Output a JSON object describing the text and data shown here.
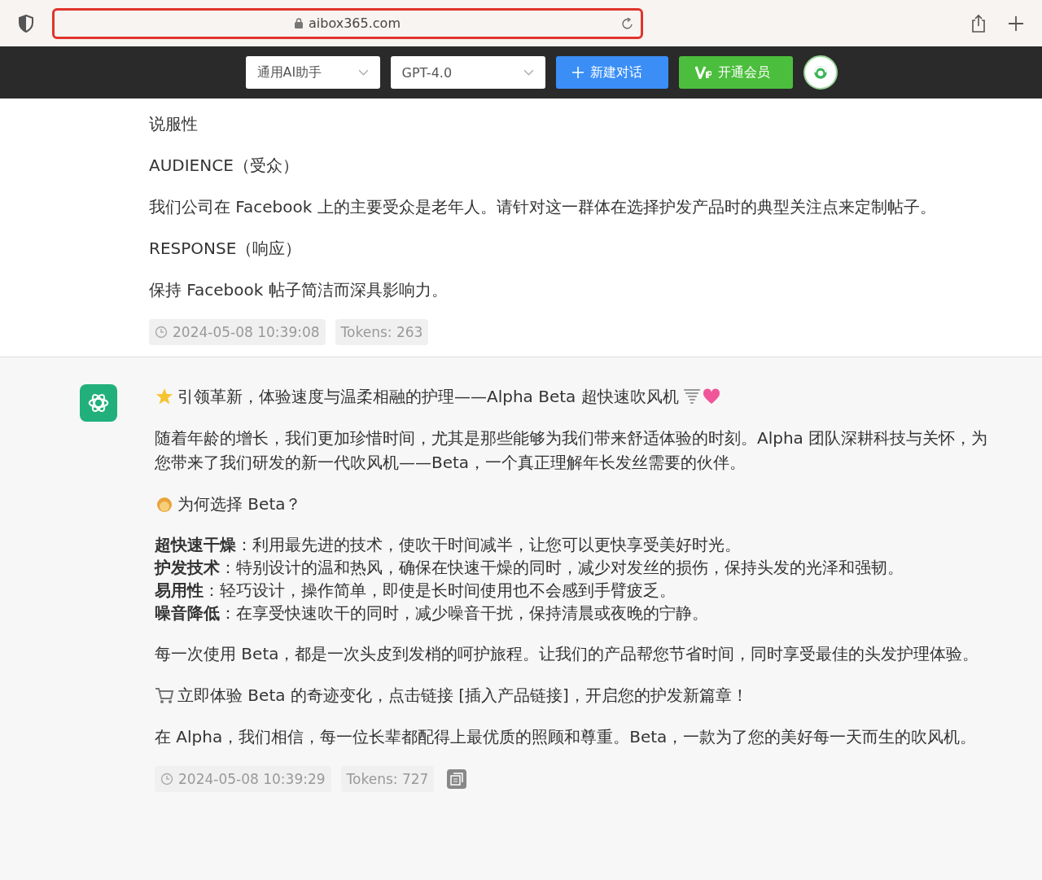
{
  "browser": {
    "url": "aibox365.com"
  },
  "toolbar": {
    "assistant_select": "通用AI助手",
    "model_select": "GPT-4.0",
    "new_chat_button": "新建对话",
    "vip_button": "开通会员"
  },
  "user_message": {
    "paragraphs": [
      "说服性",
      "AUDIENCE（受众）",
      "我们公司在 Facebook 上的主要受众是老年人。请针对这一群体在选择护发产品时的典型关注点来定制帖子。",
      "RESPONSE（响应）",
      "保持 Facebook 帖子简洁而深具影响力。"
    ],
    "timestamp": "2024-05-08 10:39:08",
    "tokens": "Tokens: 263"
  },
  "assistant_message": {
    "blocks": [
      {
        "kind": "title",
        "text": "引领革新，体验速度与温柔相融的护理——Alpha Beta 超快速吹风机"
      },
      {
        "kind": "paragraph",
        "text": "随着年龄的增长，我们更加珍惜时间，尤其是那些能够为我们带来舒适体验的时刻。Alpha 团队深耕科技与关怀，为您带来了我们研发的新一代吹风机——Beta，一个真正理解年长发丝需要的伙伴。"
      },
      {
        "kind": "question",
        "text": "为何选择 Beta？"
      },
      {
        "kind": "features",
        "items": [
          "**超快速干燥**：利用最先进的技术，使吹干时间减半，让您可以更快享受美好时光。",
          "**护发技术**：特别设计的温和热风，确保在快速干燥的同时，减少对发丝的损伤，保持头发的光泽和强韧。",
          "**易用性**：轻巧设计，操作简单，即使是长时间使用也不会感到手臂疲乏。",
          "**噪音降低**：在享受快速吹干的同时，减少噪音干扰，保持清晨或夜晚的宁静。"
        ]
      },
      {
        "kind": "paragraph",
        "text": "每一次使用 Beta，都是一次头皮到发梢的呵护旅程。让我们的产品帮您节省时间，同时享受最佳的头发护理体验。"
      },
      {
        "kind": "cta",
        "text": "立即体验 Beta 的奇迹变化，点击链接 [插入产品链接]，开启您的护发新篇章！"
      },
      {
        "kind": "paragraph",
        "text": "在 Alpha，我们相信，每一位长辈都配得上最优质的照顾和尊重。Beta，一款为了您的美好每一天而生的吹风机。"
      }
    ],
    "timestamp": "2024-05-08 10:39:29",
    "tokens": "Tokens: 727"
  }
}
